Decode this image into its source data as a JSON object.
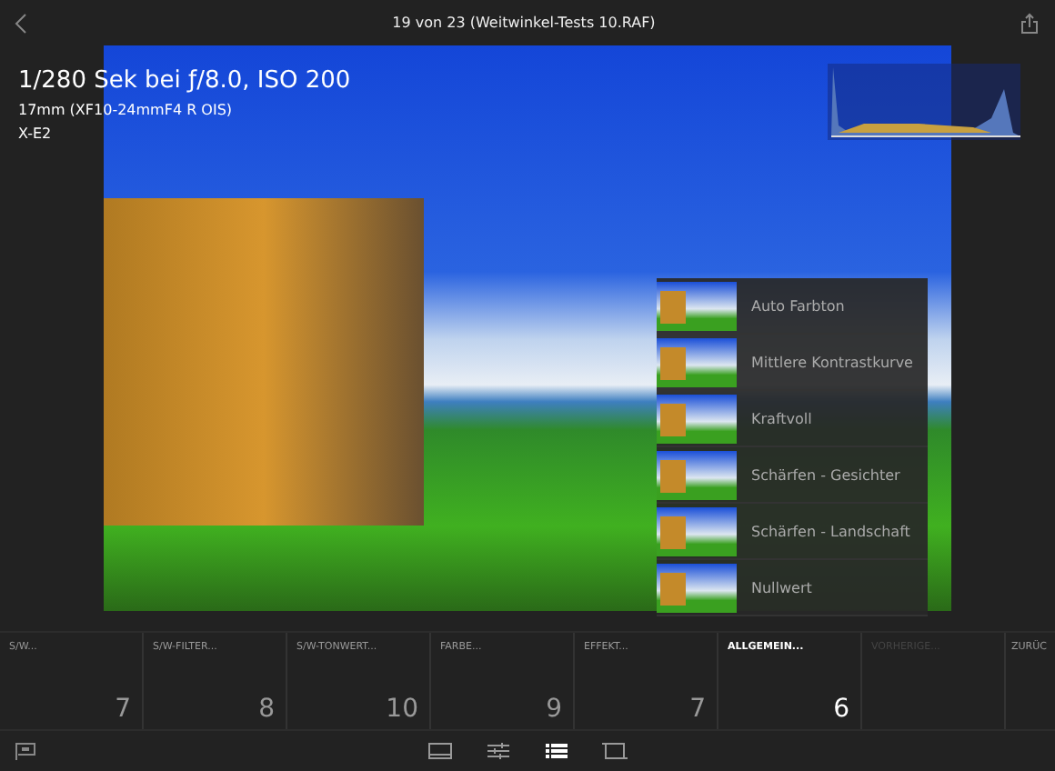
{
  "header": {
    "title": "19 von 23 (Weitwinkel-Tests 10.RAF)"
  },
  "info": {
    "exposure": "1/280 Sek bei ƒ/8.0, ISO 200",
    "lens": "17mm (XF10-24mmF4 R OIS)",
    "camera": "X-E2"
  },
  "presets": [
    {
      "label": "Auto Farbton"
    },
    {
      "label": "Mittlere Kontrastkurve"
    },
    {
      "label": "Kraftvoll"
    },
    {
      "label": "Schärfen - Gesichter"
    },
    {
      "label": "Schärfen - Landschaft"
    },
    {
      "label": "Nullwert"
    }
  ],
  "groups": [
    {
      "label": "S/W...",
      "count": "7",
      "selected": false,
      "disabled": false
    },
    {
      "label": "S/W-FILTER...",
      "count": "8",
      "selected": false,
      "disabled": false
    },
    {
      "label": "S/W-TONWERT...",
      "count": "10",
      "selected": false,
      "disabled": false
    },
    {
      "label": "FARBE...",
      "count": "9",
      "selected": false,
      "disabled": false
    },
    {
      "label": "EFFEKT...",
      "count": "7",
      "selected": false,
      "disabled": false
    },
    {
      "label": "ALLGEMEIN...",
      "count": "6",
      "selected": true,
      "disabled": false
    },
    {
      "label": "VORHERIGE...",
      "selected": false,
      "disabled": true
    },
    {
      "label": "ZURÜC",
      "selected": false,
      "disabled": false
    }
  ],
  "tools": [
    {
      "kind": "filmstrip",
      "selected": false
    },
    {
      "kind": "sliders",
      "selected": false
    },
    {
      "kind": "list",
      "selected": true
    },
    {
      "kind": "crop",
      "selected": false
    }
  ]
}
